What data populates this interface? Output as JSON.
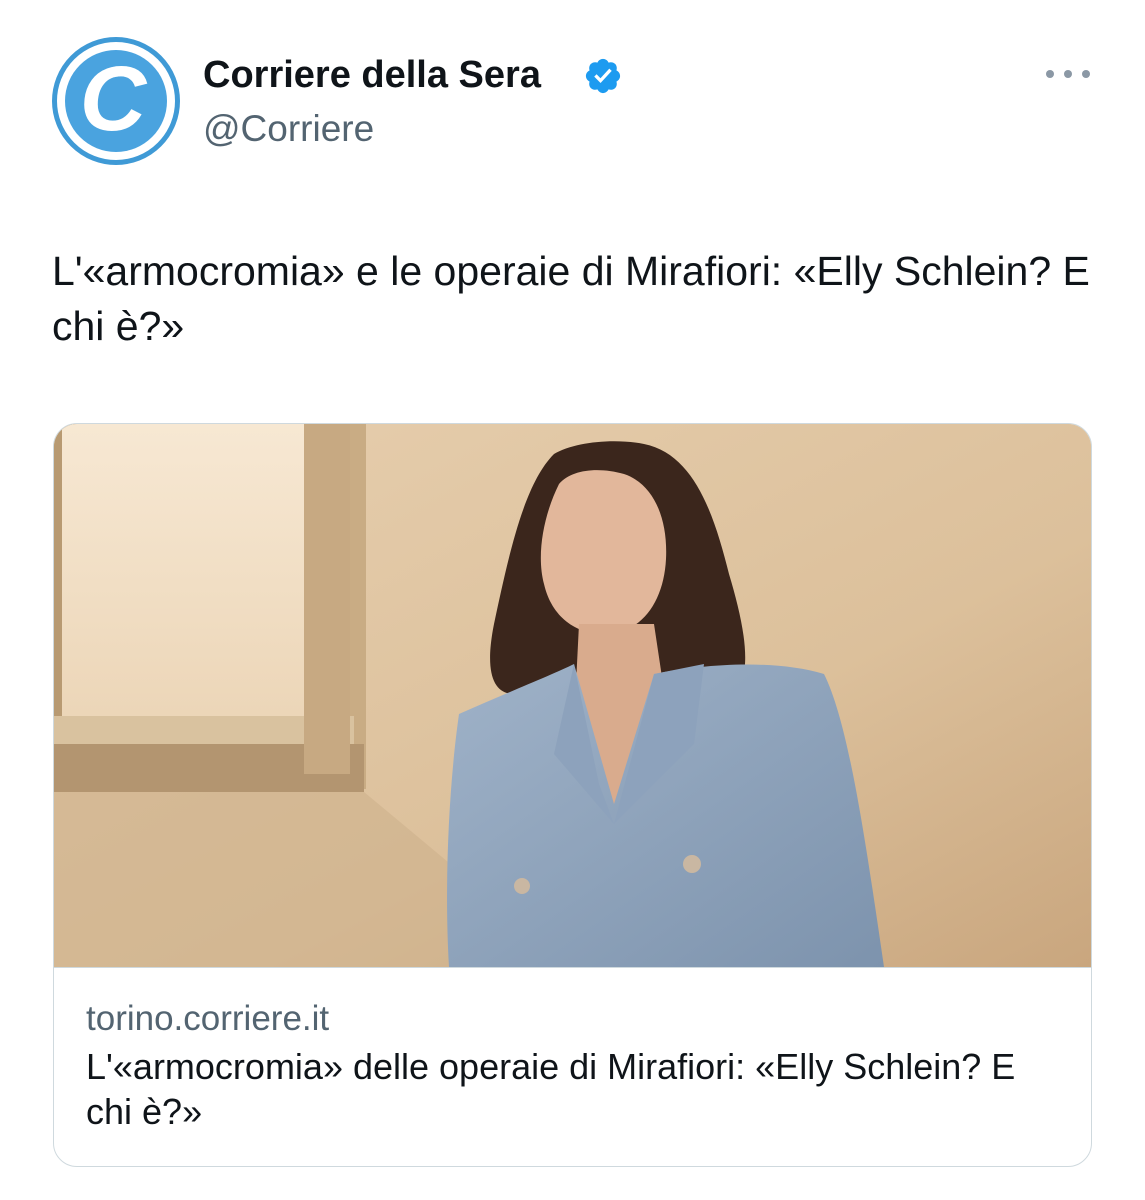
{
  "tweet": {
    "author": {
      "display_name": "Corriere della Sera",
      "handle": "@Corriere",
      "avatar_letter": "C",
      "avatar_color": "#4aa3df",
      "verified": true,
      "verified_color": "#1d9bf0"
    },
    "menu_icon": "more-dots-icon",
    "text": "L'«armocromia» e le operaie di Mirafiori: «Elly Schlein? E chi è?»",
    "link_card": {
      "image_alt": "Elly Schlein",
      "domain": "torino.corriere.it",
      "title": "L'«armocromia» delle operaie di Mirafiori: «Elly Schlein? E chi è?»"
    }
  },
  "colors": {
    "text_primary": "#0f1419",
    "text_secondary": "#536471",
    "card_border": "#cfd9de"
  }
}
